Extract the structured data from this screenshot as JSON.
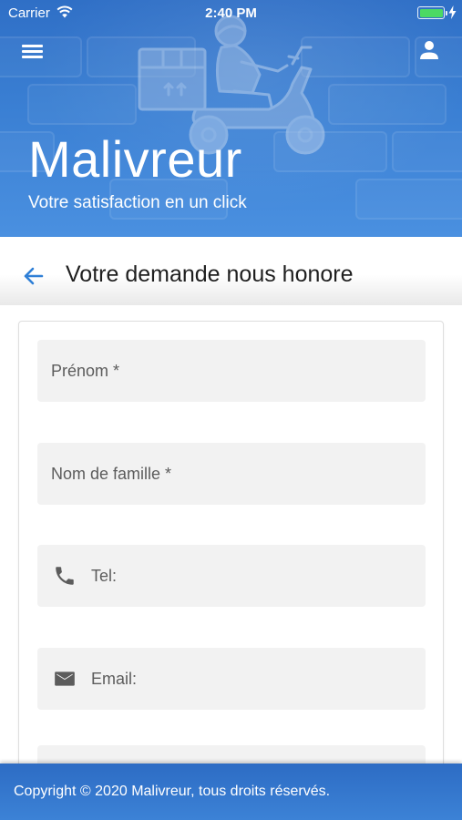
{
  "status_bar": {
    "carrier": "Carrier",
    "time": "2:40 PM",
    "battery_level": 1.0,
    "battery_color": "#4cd964"
  },
  "header": {
    "menu_icon": "hamburger-menu-icon",
    "user_icon": "user-icon",
    "brand_title": "Malivreur",
    "brand_subtitle": "Votre satisfaction en un click",
    "illustration": "delivery-scooter-illustration",
    "background_color": "#3a7fd3"
  },
  "section": {
    "back_icon": "arrow-left-icon",
    "title": "Votre demande nous honore",
    "accent_color": "#2f7fd6"
  },
  "form": {
    "fields": [
      {
        "label": "Prénom *",
        "icon": ""
      },
      {
        "label": "Nom de famille *",
        "icon": ""
      },
      {
        "label": "Tel:",
        "icon": "phone-icon"
      },
      {
        "label": "Email:",
        "icon": "mail-icon"
      }
    ]
  },
  "footer": {
    "copyright": "Copyright © 2020 Malivreur, tous droits réservés.",
    "background_color": "#3579cf"
  }
}
